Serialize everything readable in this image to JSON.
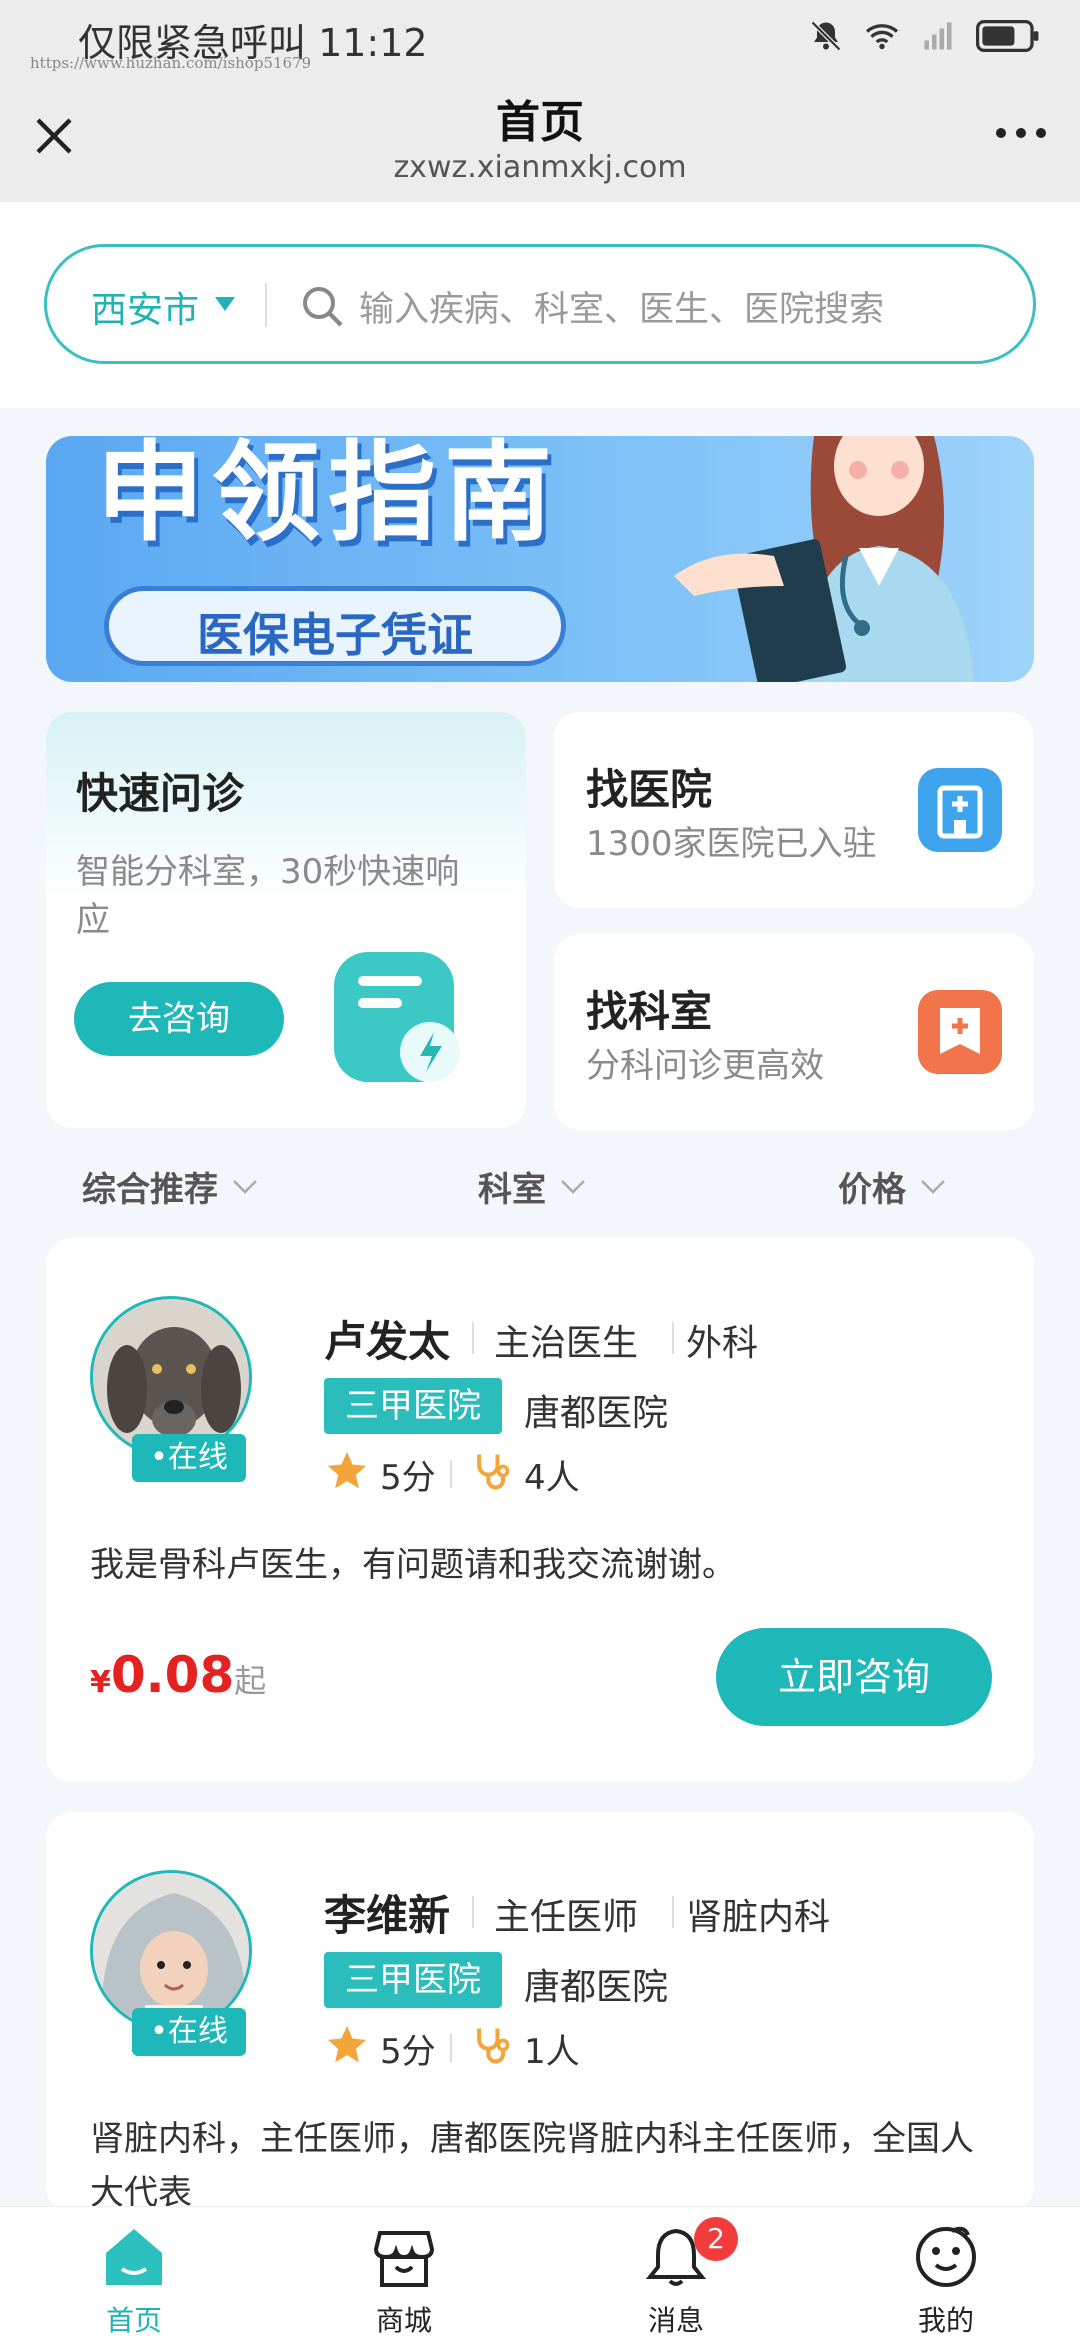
{
  "status_bar": {
    "left_text": "仅限紧急呼叫 11:12",
    "watermark": "https://www.huzhan.com/ishop51679"
  },
  "nav": {
    "title": "首页",
    "subtitle": "zxwz.xianmxkj.com"
  },
  "search": {
    "city": "西安市",
    "placeholder": "输入疾病、科室、医生、医院搜索"
  },
  "banner": {
    "headline": "申领指南",
    "pill_text": "医保电子凭证"
  },
  "quick_consult": {
    "title": "快速问诊",
    "desc": "智能分科室，30秒快速响应",
    "button": "去咨询"
  },
  "find_hospital": {
    "title": "找医院",
    "desc": "1300家医院已入驻"
  },
  "find_department": {
    "title": "找科室",
    "desc": "分科问诊更高效"
  },
  "filters": [
    "综合推荐",
    "科室",
    "价格"
  ],
  "doctors": [
    {
      "name": "卢发太",
      "title": "主治医生",
      "department": "外科",
      "badge": "三甲医院",
      "hospital": "唐都医院",
      "score": "5分",
      "consult_count": "4人",
      "status": "在线",
      "intro": "我是骨科卢医生，有问题请和我交流谢谢。",
      "price_symbol": "¥",
      "price": "0.08",
      "price_suffix": "起",
      "cta": "立即咨询"
    },
    {
      "name": "李维新",
      "title": "主任医师",
      "department": "肾脏内科",
      "badge": "三甲医院",
      "hospital": "唐都医院",
      "score": "5分",
      "consult_count": "1人",
      "status": "在线",
      "intro": "肾脏内科，主任医师，唐都医院肾脏内科主任医师，全国人大代表"
    }
  ],
  "tabbar": {
    "items": [
      {
        "label": "首页",
        "icon": "home-icon",
        "active": true
      },
      {
        "label": "商城",
        "icon": "shop-icon",
        "active": false
      },
      {
        "label": "消息",
        "icon": "bell-icon",
        "active": false,
        "badge": "2"
      },
      {
        "label": "我的",
        "icon": "profile-icon",
        "active": false
      }
    ]
  },
  "colors": {
    "accent": "#1fb8b8",
    "price": "#e42222",
    "background": "#f3f6fb"
  }
}
